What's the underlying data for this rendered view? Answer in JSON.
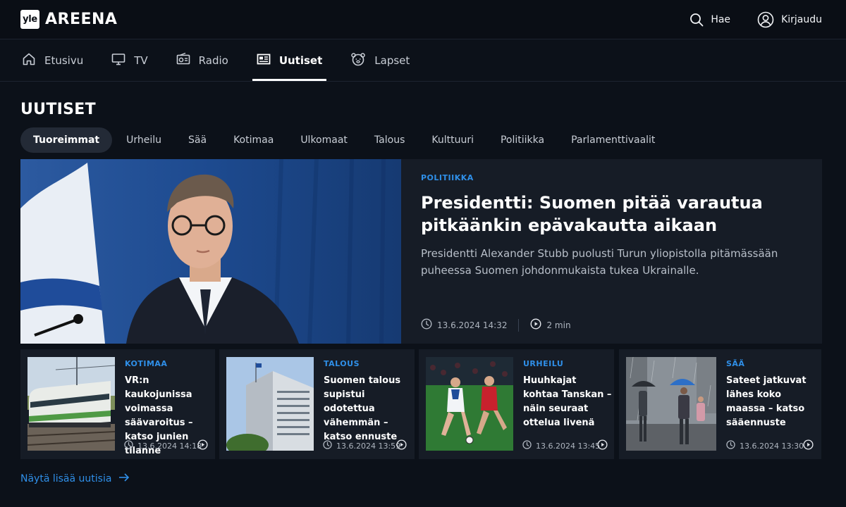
{
  "header": {
    "logo_badge": "yle",
    "logo_text": "AREENA",
    "search_label": "Hae",
    "login_label": "Kirjaudu"
  },
  "nav": {
    "items": [
      {
        "label": "Etusivu",
        "icon": "home-icon"
      },
      {
        "label": "TV",
        "icon": "tv-icon"
      },
      {
        "label": "Radio",
        "icon": "radio-icon"
      },
      {
        "label": "Uutiset",
        "icon": "news-icon",
        "active": true
      },
      {
        "label": "Lapset",
        "icon": "kids-icon"
      }
    ]
  },
  "section": {
    "title": "UUTISET",
    "chips": [
      "Tuoreimmat",
      "Urheilu",
      "Sää",
      "Kotimaa",
      "Ulkomaat",
      "Talous",
      "Kulttuuri",
      "Politiikka",
      "Parlamenttivaalit"
    ],
    "active_chip": "Tuoreimmat"
  },
  "hero": {
    "category": "POLITIIKKA",
    "title": "Presidentti: Suomen pitää varautua pitkäänkin epävakautta aikaan",
    "description": "Presidentti Alexander Stubb puolusti Turun yliopistolla pitämässään puheessa Suomen johdonmukaista tukea Ukrainalle.",
    "timestamp": "13.6.2024 14:32",
    "duration": "2 min"
  },
  "cards": [
    {
      "category": "KOTIMAA",
      "title": "VR:n kaukojunissa voimassa säävaroitus – katso junien tilanne",
      "timestamp": "13.6.2024 14:18"
    },
    {
      "category": "TALOUS",
      "title": "Suomen talous supistui odotettua vähemmän – katso ennuste",
      "timestamp": "13.6.2024 13:59"
    },
    {
      "category": "URHEILU",
      "title": "Huuhkajat kohtaa Tanskan – näin seuraat ottelua livenä",
      "timestamp": "13.6.2024 13:45"
    },
    {
      "category": "SÄÄ",
      "title": "Sateet jatkuvat lähes koko maassa – katso sääennuste",
      "timestamp": "13.6.2024 13:30"
    }
  ],
  "more_link": "Näytä lisää uutisia",
  "colors": {
    "background": "#0c1119",
    "card": "#161c26",
    "accent": "#2f8fe8"
  }
}
